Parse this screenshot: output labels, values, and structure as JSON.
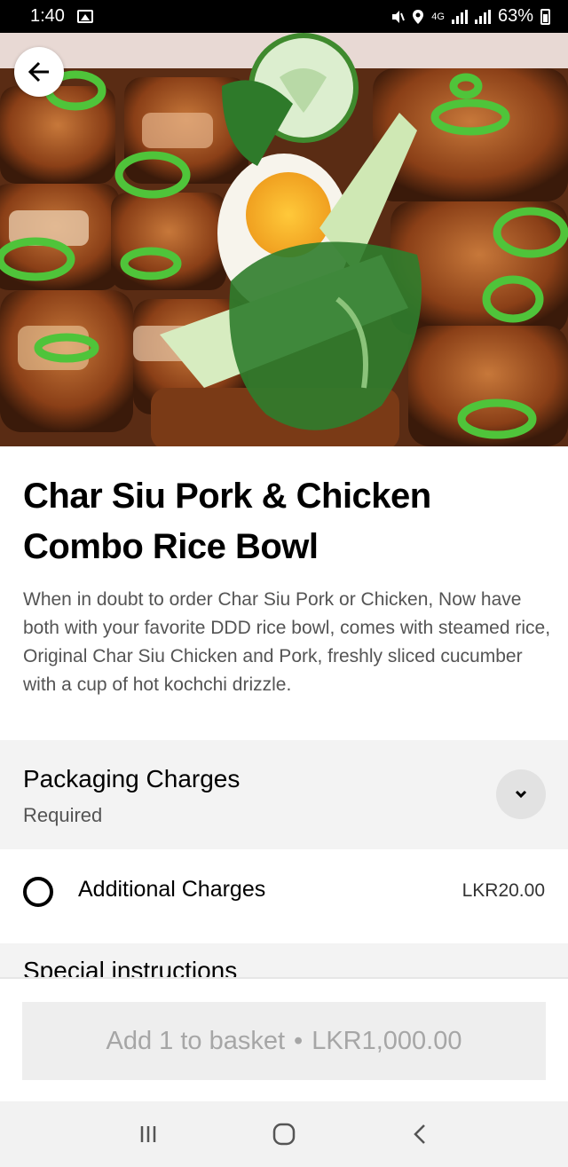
{
  "status_bar": {
    "time": "1:40",
    "network": "4G",
    "battery": "63%"
  },
  "item": {
    "title": "Char Siu Pork & Chicken Combo Rice Bowl",
    "description": "When in doubt to order Char Siu Pork or Chicken, Now have both with your favorite DDD rice bowl, comes with steamed rice, Original Char Siu Chicken and Pork, freshly sliced cucumber with a cup of hot kochchi drizzle."
  },
  "packaging": {
    "title": "Packaging Charges",
    "subtitle": "Required",
    "options": [
      {
        "label": "Additional Charges",
        "price": "LKR20.00",
        "selected": false
      }
    ]
  },
  "special_instructions": {
    "title": "Special instructions"
  },
  "basket_button": {
    "label": "Add 1 to basket",
    "separator": "•",
    "price": "LKR1,000.00"
  },
  "icons": {
    "back": "arrow-left-icon",
    "expand": "chevron-down-icon",
    "nav_recent": "recent-apps-icon",
    "nav_home": "home-icon",
    "nav_back": "back-icon"
  },
  "colors": {
    "text_primary": "#000000",
    "text_secondary": "#545454",
    "section_bg": "#f3f3f3",
    "button_disabled_bg": "#eeeeee",
    "button_disabled_text": "#a6a6a6"
  }
}
